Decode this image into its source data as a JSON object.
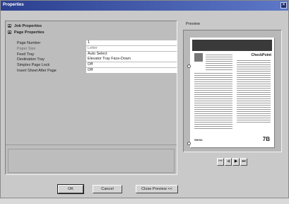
{
  "window": {
    "title": "Properties",
    "close_glyph": "✕"
  },
  "tree": {
    "job_properties": "Job Properties",
    "page_properties": "Page Properties"
  },
  "properties": [
    {
      "name": "Page Number",
      "value": "1",
      "enabled": true
    },
    {
      "name": "Paper Size",
      "value": "Letter",
      "enabled": false
    },
    {
      "name": "Feed Tray",
      "value": "Auto Select",
      "enabled": true
    },
    {
      "name": "Destination Tray",
      "value": "Elevator Tray Face-Down",
      "enabled": true
    },
    {
      "name": "Simplex Page Lock",
      "value": "Off",
      "enabled": true
    },
    {
      "name": "Insert Sheet After Page",
      "value": "Off",
      "enabled": true
    }
  ],
  "preview": {
    "label": "Preview",
    "doc_brand": "CheckPoint",
    "doc_footer_logo": "Xerox",
    "doc_footer_mark": "7B",
    "nav": {
      "first": "⏮",
      "prev": "◀",
      "next": "▶",
      "last": "⏭"
    }
  },
  "buttons": {
    "ok": "OK",
    "cancel": "Cancel",
    "close_preview": "Close Preview <<"
  },
  "icons": {
    "close": "close-icon",
    "collapse": "collapse-icon",
    "expand": "expand-icon",
    "first": "first-page-icon",
    "prev": "previous-page-icon",
    "next": "next-page-icon",
    "last": "last-page-icon"
  }
}
